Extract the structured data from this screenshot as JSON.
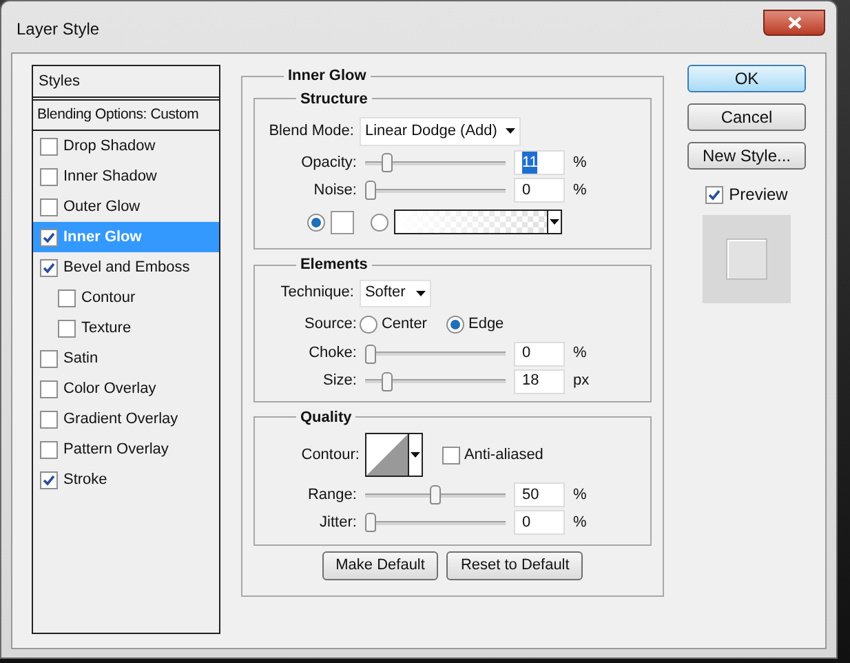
{
  "window": {
    "title": "Layer Style"
  },
  "styles_list": [
    {
      "kind": "heading",
      "label": "Styles",
      "selected": false
    },
    {
      "kind": "plain",
      "label": "Blending Options: Custom",
      "selected": false
    },
    {
      "kind": "checkbox",
      "label": "Drop Shadow",
      "checked": false,
      "selected": false
    },
    {
      "kind": "checkbox",
      "label": "Inner Shadow",
      "checked": false,
      "selected": false
    },
    {
      "kind": "checkbox",
      "label": "Outer Glow",
      "checked": false,
      "selected": false
    },
    {
      "kind": "checkbox",
      "label": "Inner Glow",
      "checked": true,
      "selected": true
    },
    {
      "kind": "checkbox",
      "label": "Bevel and Emboss",
      "checked": true,
      "selected": false,
      "children": [
        {
          "kind": "checkbox",
          "label": "Contour",
          "checked": false,
          "selected": false
        },
        {
          "kind": "checkbox",
          "label": "Texture",
          "checked": false,
          "selected": false
        }
      ]
    },
    {
      "kind": "checkbox",
      "label": "Satin",
      "checked": false,
      "selected": false
    },
    {
      "kind": "checkbox",
      "label": "Color Overlay",
      "checked": false,
      "selected": false
    },
    {
      "kind": "checkbox",
      "label": "Gradient Overlay",
      "checked": false,
      "selected": false
    },
    {
      "kind": "checkbox",
      "label": "Pattern Overlay",
      "checked": false,
      "selected": false
    },
    {
      "kind": "checkbox",
      "label": "Stroke",
      "checked": true,
      "selected": false
    }
  ],
  "inner_glow": {
    "title": "Inner Glow",
    "structure": {
      "title": "Structure",
      "blend_mode": {
        "label": "Blend Mode:",
        "value": "Linear Dodge (Add)"
      },
      "sliders": [
        {
          "label": "Opacity:",
          "level": 0.13,
          "value": "11",
          "unit": "%",
          "highlighted": true
        },
        {
          "label": "Noise:",
          "level": 0,
          "value": "0",
          "unit": "%",
          "highlighted": false
        }
      ],
      "fill_options": [
        {
          "kind": "swatch",
          "selected": true
        },
        {
          "kind": "gradient",
          "selected": false
        }
      ]
    },
    "elements": {
      "title": "Elements",
      "technique": {
        "label": "Technique:",
        "value": "Softer"
      },
      "source": {
        "label": "Source:",
        "options": [
          {
            "label": "Center",
            "selected": false
          },
          {
            "label": "Edge",
            "selected": true
          }
        ]
      },
      "sliders": [
        {
          "label": "Choke:",
          "level": 0,
          "value": "0",
          "unit": "%",
          "highlighted": false
        },
        {
          "label": "Size:",
          "level": 0.13,
          "value": "18",
          "unit": "px",
          "highlighted": false
        }
      ]
    },
    "quality": {
      "title": "Quality",
      "contour": {
        "label": "Contour:"
      },
      "anti_aliased": {
        "label": "Anti-aliased",
        "checked": false
      },
      "sliders": [
        {
          "label": "Range:",
          "level": 0.5,
          "value": "50",
          "unit": "%",
          "highlighted": false
        },
        {
          "label": "Jitter:",
          "level": 0,
          "value": "0",
          "unit": "%",
          "highlighted": false
        }
      ]
    },
    "buttons": [
      "Make Default",
      "Reset to Default"
    ]
  },
  "side_buttons": [
    {
      "label": "OK",
      "default": true
    },
    {
      "label": "Cancel",
      "default": false
    },
    {
      "label": "New Style...",
      "default": false
    }
  ],
  "preview": {
    "label": "Preview",
    "checked": true
  }
}
